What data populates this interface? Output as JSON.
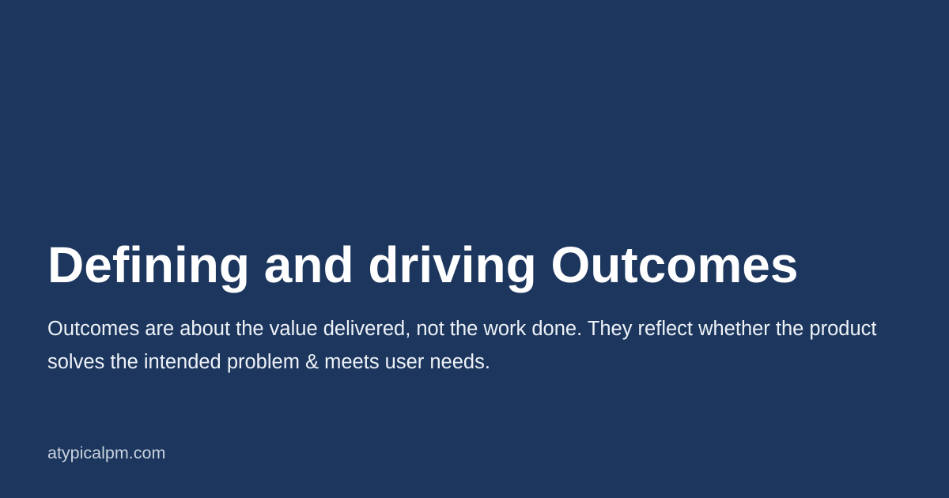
{
  "card": {
    "title": "Defining and driving Outcomes",
    "description": "Outcomes are about the value delivered, not the work done. They reflect whether the product solves the intended problem & meets user needs.",
    "site": "atypicalpm.com"
  },
  "colors": {
    "background": "#1c365e",
    "title": "#ffffff",
    "description": "#eef2f7",
    "site": "#c9d2de"
  }
}
